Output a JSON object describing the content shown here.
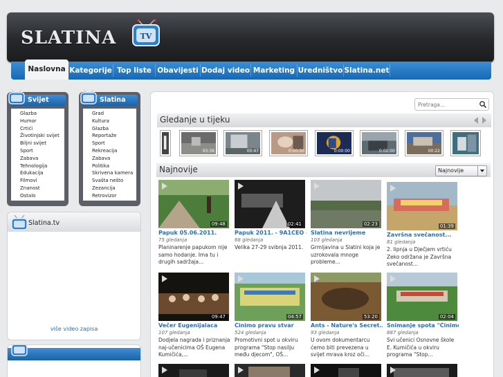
{
  "site": {
    "name": "SLATINA",
    "tv_badge": "TV"
  },
  "nav": [
    "Naslovna",
    "Kategorije",
    "Top liste",
    "Obavijesti",
    "Dodaj video",
    "Marketing",
    "Uredništvo",
    "Slatina.net"
  ],
  "sidebar_svijet": {
    "title": "Svijet",
    "items": [
      "Glazba",
      "Humor",
      "Crtići",
      "Životinjski svijet",
      "Biljni svijet",
      "Sport",
      "Zabava",
      "Tehnologija",
      "Edukacija",
      "Filmovi",
      "Znanost",
      "Ostalo"
    ]
  },
  "sidebar_slatina": {
    "title": "Slatina",
    "items": [
      "Grad",
      "Kultura",
      "Glazba",
      "Reportaže",
      "Sport",
      "Rekreacija",
      "Zabava",
      "Politika",
      "Skrivena kamera",
      "Svašta nešto",
      "Zezancija",
      "Retrovizor"
    ]
  },
  "slatina_tv": {
    "title": "Slatina.tv",
    "more_link": "više video zapisa"
  },
  "search": {
    "placeholder": "Pretraga..."
  },
  "watching_now": {
    "title": "Gledanje u tijeku",
    "times": [
      "",
      "03:39",
      "00:47",
      "0:00:00",
      "0:00:00",
      "0:00:00",
      "00:22",
      ""
    ]
  },
  "latest": {
    "title": "Najnovije",
    "sort_value": "Najnovije",
    "videos": [
      {
        "title": "Papuk 05.06.2011.",
        "views": "75 gledanja",
        "duration": "09:48",
        "desc": "Planinarenje papukom nije samo hodanje. Ima tu i drugih sadržaja..."
      },
      {
        "title": "Papuk 2011. - 9A1CEO -...",
        "views": "68 gledanja",
        "duration": "02:41",
        "desc": "Velika 27-29 svibnja 2011."
      },
      {
        "title": "Slatina nevrijeme",
        "views": "103 gledanja",
        "duration": "02:23",
        "desc": "Grmljavina u Slatini koja je uzrokovala mnoge probleme..."
      },
      {
        "title": "Završna svečanost...",
        "views": "81 gledanja",
        "duration": "01:39",
        "desc": "2. lipnja u Dječjem vrtiću Zeko održana je Završna svečanost..."
      },
      {
        "title": "Večer Eugenijalaca",
        "views": "107 gledanja",
        "duration": "09:47",
        "desc": "Dodjela nagrada i priznanja naj-učenicima OŠ Eugena Kumičića,..."
      },
      {
        "title": "Činimo pravu stvar",
        "views": "524 gledanja",
        "duration": "04:57",
        "desc": "Promotivni spot u okviru programa \"Stop nasilju među djecom\", OŠ..."
      },
      {
        "title": "Ants - Nature's Secret...",
        "views": "93 gledanja",
        "duration": "53:20",
        "desc": "U ovom dokumentarcu ćemo biti prevezena u svijet mrava kroz oči..."
      },
      {
        "title": "Snimanje spota \"Činimo...",
        "views": "887 gledanja",
        "duration": "02:04",
        "desc": "Svi učenici Osnovne škole E. Kumičića u okviru programa \"Stop..."
      }
    ]
  }
}
